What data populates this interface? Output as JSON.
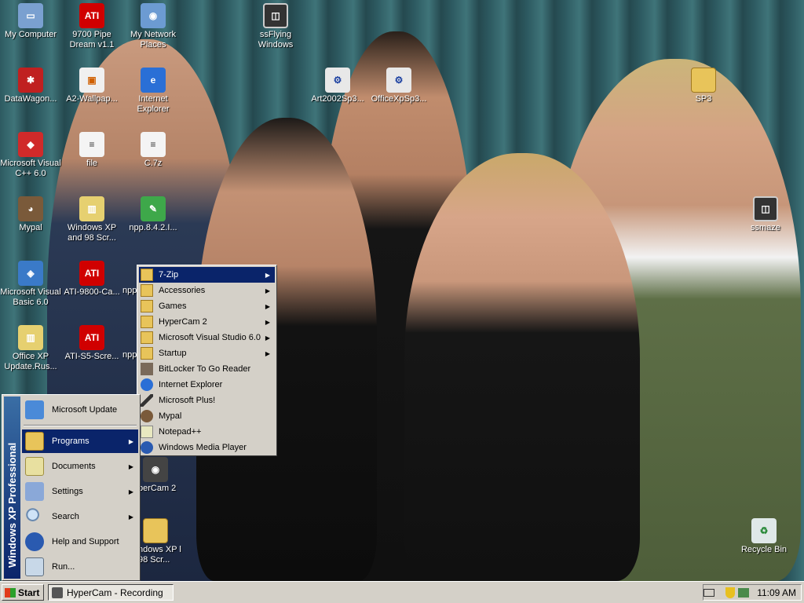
{
  "desktop": {
    "icons": [
      {
        "label": "My Computer"
      },
      {
        "label": "9700 Pipe Dream v1.1"
      },
      {
        "label": "My Network Places"
      },
      {
        "label": "ssFlying Windows"
      },
      {
        "label": "DataWagon..."
      },
      {
        "label": "A2-Wallpap..."
      },
      {
        "label": "Internet Explorer"
      },
      {
        "label": "Art2002Sp3..."
      },
      {
        "label": "OfficeXpSp3..."
      },
      {
        "label": "SP3"
      },
      {
        "label": "Microsoft Visual C++ 6.0"
      },
      {
        "label": "file"
      },
      {
        "label": "C.7z"
      },
      {
        "label": "Mypal"
      },
      {
        "label": "Windows XP and 98 Scr..."
      },
      {
        "label": "npp.8.4.2.I..."
      },
      {
        "label": "ssmaze"
      },
      {
        "label": "Microsoft Visual Basic 6.0"
      },
      {
        "label": "ATI-9800-Ca..."
      },
      {
        "label": "npp"
      },
      {
        "label": "Office XP Update.Rus..."
      },
      {
        "label": "ATI-S5-Scre..."
      },
      {
        "label": "npp"
      },
      {
        "label": "perCam 2"
      },
      {
        "label": "ndows XP l 98 Scr..."
      },
      {
        "label": "Recycle Bin"
      }
    ]
  },
  "start_menu": {
    "banner": "Windows XP Professional",
    "items": [
      {
        "label": "Microsoft Update"
      },
      {
        "label": "Programs"
      },
      {
        "label": "Documents"
      },
      {
        "label": "Settings"
      },
      {
        "label": "Search"
      },
      {
        "label": "Help and Support"
      },
      {
        "label": "Run..."
      }
    ]
  },
  "programs_menu": {
    "items": [
      {
        "label": "7-Zip"
      },
      {
        "label": "Accessories"
      },
      {
        "label": "Games"
      },
      {
        "label": "HyperCam 2"
      },
      {
        "label": "Microsoft Visual Studio 6.0"
      },
      {
        "label": "Startup"
      },
      {
        "label": "BitLocker To Go Reader"
      },
      {
        "label": "Internet Explorer"
      },
      {
        "label": "Microsoft Plus!"
      },
      {
        "label": "Mypal"
      },
      {
        "label": "Notepad++"
      },
      {
        "label": "Windows Media Player"
      }
    ]
  },
  "taskbar": {
    "start_label": "Start",
    "task_label": "HyperCam - Recording",
    "clock": "11:09 AM"
  },
  "icons": {
    "arrow": "▶"
  }
}
